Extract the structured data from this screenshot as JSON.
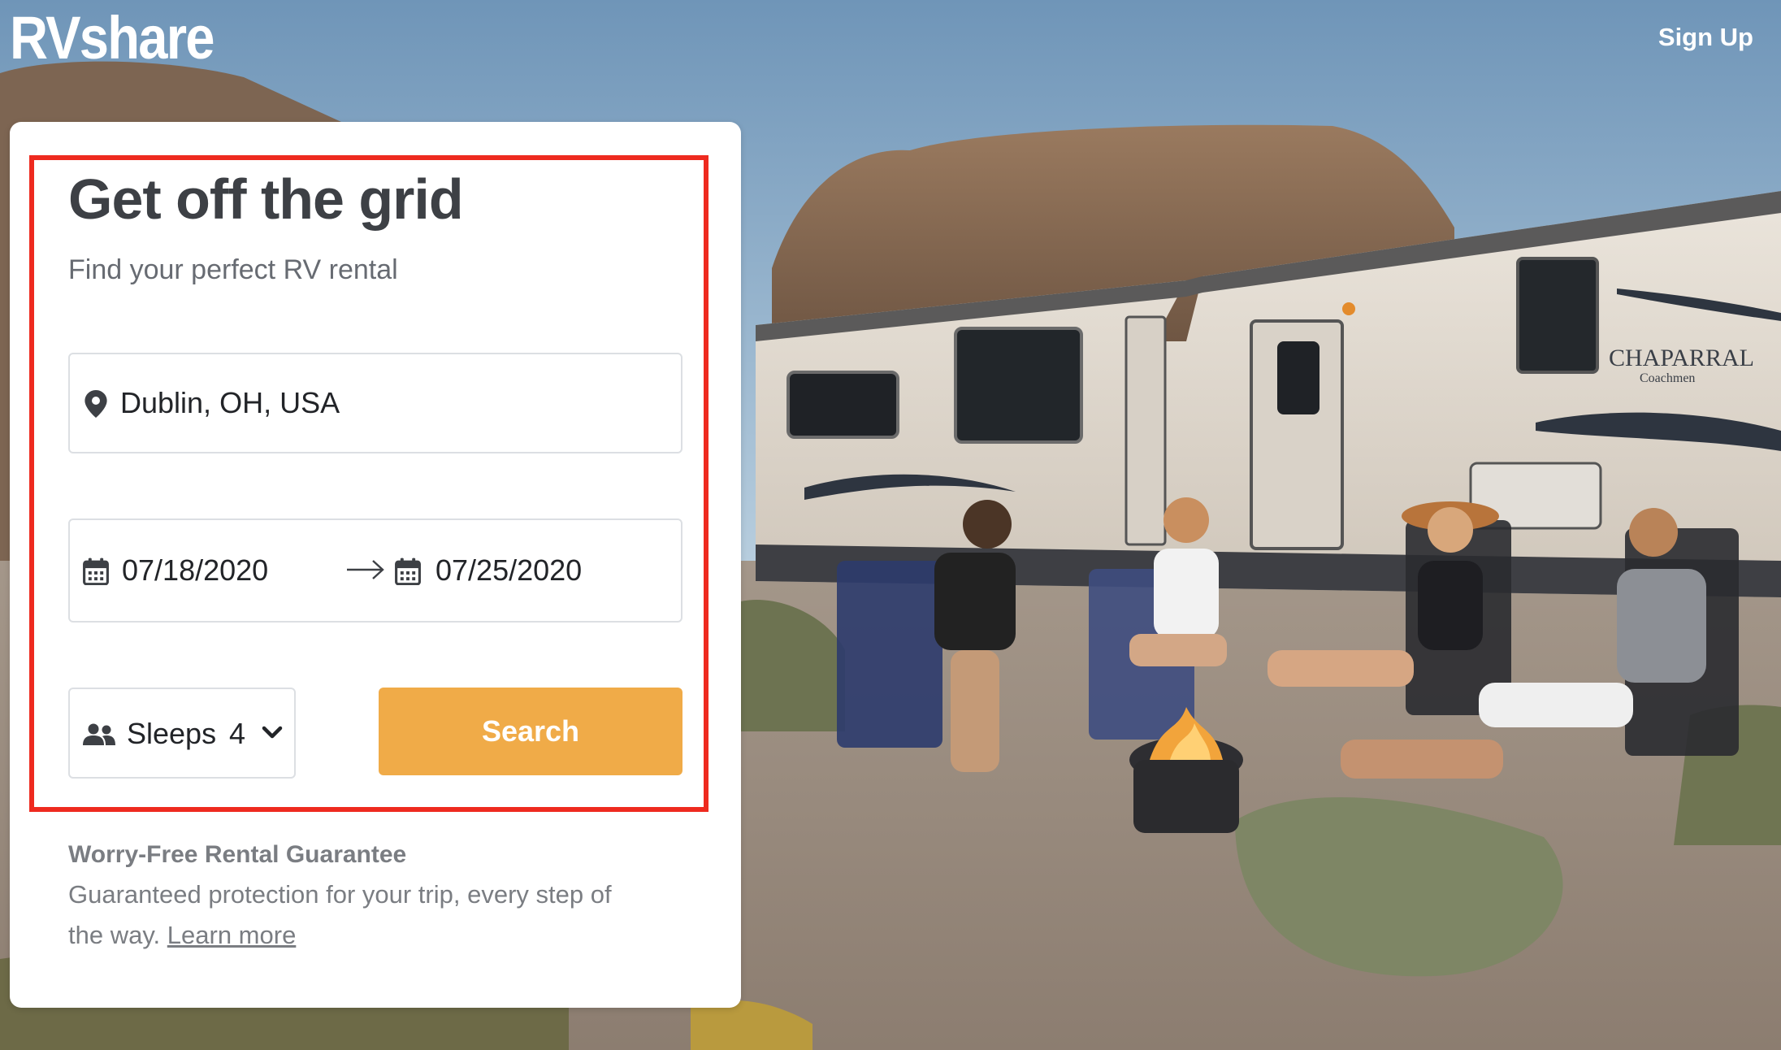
{
  "header": {
    "logo": "RVshare",
    "signup_label": "Sign Up"
  },
  "search_card": {
    "title": "Get off the grid",
    "subtitle": "Find your perfect RV rental",
    "location": {
      "value": "Dublin, OH, USA",
      "icon": "map-pin-icon"
    },
    "dates": {
      "start": "07/18/2020",
      "end": "07/25/2020",
      "icon": "calendar-icon",
      "separator_icon": "arrow-right-icon"
    },
    "sleeps": {
      "label": "Sleeps",
      "value": "4",
      "icon": "people-icon",
      "dropdown_icon": "chevron-down-icon"
    },
    "search_label": "Search",
    "guarantee": {
      "title": "Worry-Free Rental Guarantee",
      "text": "Guaranteed protection for your trip, every step of the way.",
      "link_label": "Learn more"
    }
  },
  "colors": {
    "accent": "#f0ab48",
    "highlight": "#ee2a1f",
    "title": "#3d4045",
    "muted": "#7a7d82"
  }
}
